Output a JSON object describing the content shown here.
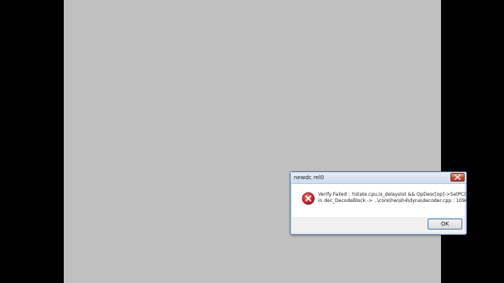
{
  "dialog": {
    "title": "newdc rel0",
    "message_line1": "Verify Failed  : !(state.cpu.is_delayslot && OpDesc[op]->SetPC())",
    "message_line2": "in dec_DecodeBlock -> ..\\core\\hw\\sh4\\dyna\\decoder.cpp : 1094",
    "ok_label": "OK",
    "icon": "error-icon",
    "close_icon": "close-icon"
  },
  "colors": {
    "canvas_background": "#c0c0c0",
    "outer_background": "#000000",
    "error_red": "#d52b2b",
    "close_button_red": "#c9472f"
  }
}
